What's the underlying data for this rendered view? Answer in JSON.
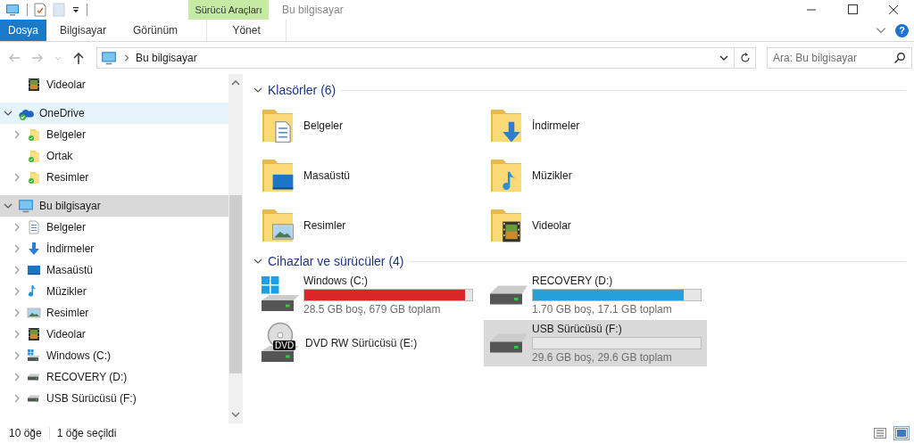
{
  "window": {
    "title": "Bu bilgisayar",
    "context_group": "Sürücü Araçları"
  },
  "ribbon": {
    "file_tab": "Dosya",
    "tabs": [
      {
        "label": "Bilgisayar",
        "context": false
      },
      {
        "label": "Görünüm",
        "context": false
      },
      {
        "label": "Yönet",
        "context": true
      }
    ],
    "help_label": "?"
  },
  "address": {
    "path": "Bu bilgisayar",
    "search": {
      "placeholder": "Ara: Bu bilgisayar"
    }
  },
  "nav_top": [
    {
      "label": "Videolar",
      "kind": "video"
    }
  ],
  "tree": [
    {
      "label": "OneDrive",
      "kind": "onedrive",
      "expanded": true,
      "selected": false,
      "hover": true,
      "children": [
        {
          "label": "Belgeler",
          "kind": "folder-sync",
          "expandable": true,
          "selected": false
        },
        {
          "label": "Ortak",
          "kind": "folder-sync",
          "expandable": false,
          "selected": false
        },
        {
          "label": "Resimler",
          "kind": "folder-sync",
          "expandable": true,
          "selected": false
        }
      ]
    },
    {
      "label": "Bu bilgisayar",
      "kind": "pc",
      "expanded": true,
      "selected": true,
      "hover": false,
      "children": [
        {
          "label": "Belgeler",
          "kind": "documents",
          "expandable": true,
          "selected": false
        },
        {
          "label": "İndirmeler",
          "kind": "downloads",
          "expandable": true,
          "selected": false
        },
        {
          "label": "Masaüstü",
          "kind": "desktop",
          "expandable": true,
          "selected": false
        },
        {
          "label": "Müzikler",
          "kind": "music",
          "expandable": true,
          "selected": false
        },
        {
          "label": "Resimler",
          "kind": "pictures",
          "expandable": true,
          "selected": false
        },
        {
          "label": "Videolar",
          "kind": "video",
          "expandable": true,
          "selected": false
        },
        {
          "label": "Windows (C:)",
          "kind": "windows-drive",
          "expandable": true,
          "selected": false
        },
        {
          "label": "RECOVERY (D:)",
          "kind": "drive",
          "expandable": true,
          "selected": false
        },
        {
          "label": "USB Sürücüsü (F:)",
          "kind": "drive",
          "expandable": true,
          "selected": false
        }
      ]
    }
  ],
  "folders": {
    "title": "Klasörler (6)",
    "expanded": true,
    "items": [
      {
        "label": "Belgeler",
        "kind": "documents"
      },
      {
        "label": "İndirmeler",
        "kind": "downloads"
      },
      {
        "label": "Masaüstü",
        "kind": "desktop"
      },
      {
        "label": "Müzikler",
        "kind": "music"
      },
      {
        "label": "Resimler",
        "kind": "pictures"
      },
      {
        "label": "Videolar",
        "kind": "video"
      }
    ]
  },
  "drives": {
    "title": "Cihazlar ve sürücüler (4)",
    "expanded": true,
    "items": [
      {
        "kind": "windows-drive",
        "label": "Windows (C:)",
        "level": 0.958,
        "color": "#da2626",
        "caption": "28.5 GB boş, 679 GB toplam",
        "selected": false
      },
      {
        "kind": "drive",
        "label": "RECOVERY (D:)",
        "level": 0.9,
        "color": "#26a0da",
        "caption": "1.70 GB boş, 17.1 GB toplam",
        "selected": false
      },
      {
        "kind": "dvd",
        "label": "DVD RW Sürücüsü (E:)",
        "badge": "DVD",
        "selected": false
      },
      {
        "kind": "drive",
        "label": "USB Sürücüsü (F:)",
        "level": 0,
        "caption": "29.6 GB boş, 29.6 GB toplam",
        "selected": true
      }
    ]
  },
  "status_bar": {
    "count": "10 öğe",
    "selection": "1 öğe seçildi",
    "views": [
      {
        "kind": "details",
        "selected": false
      },
      {
        "kind": "large-icons",
        "selected": true
      }
    ]
  }
}
